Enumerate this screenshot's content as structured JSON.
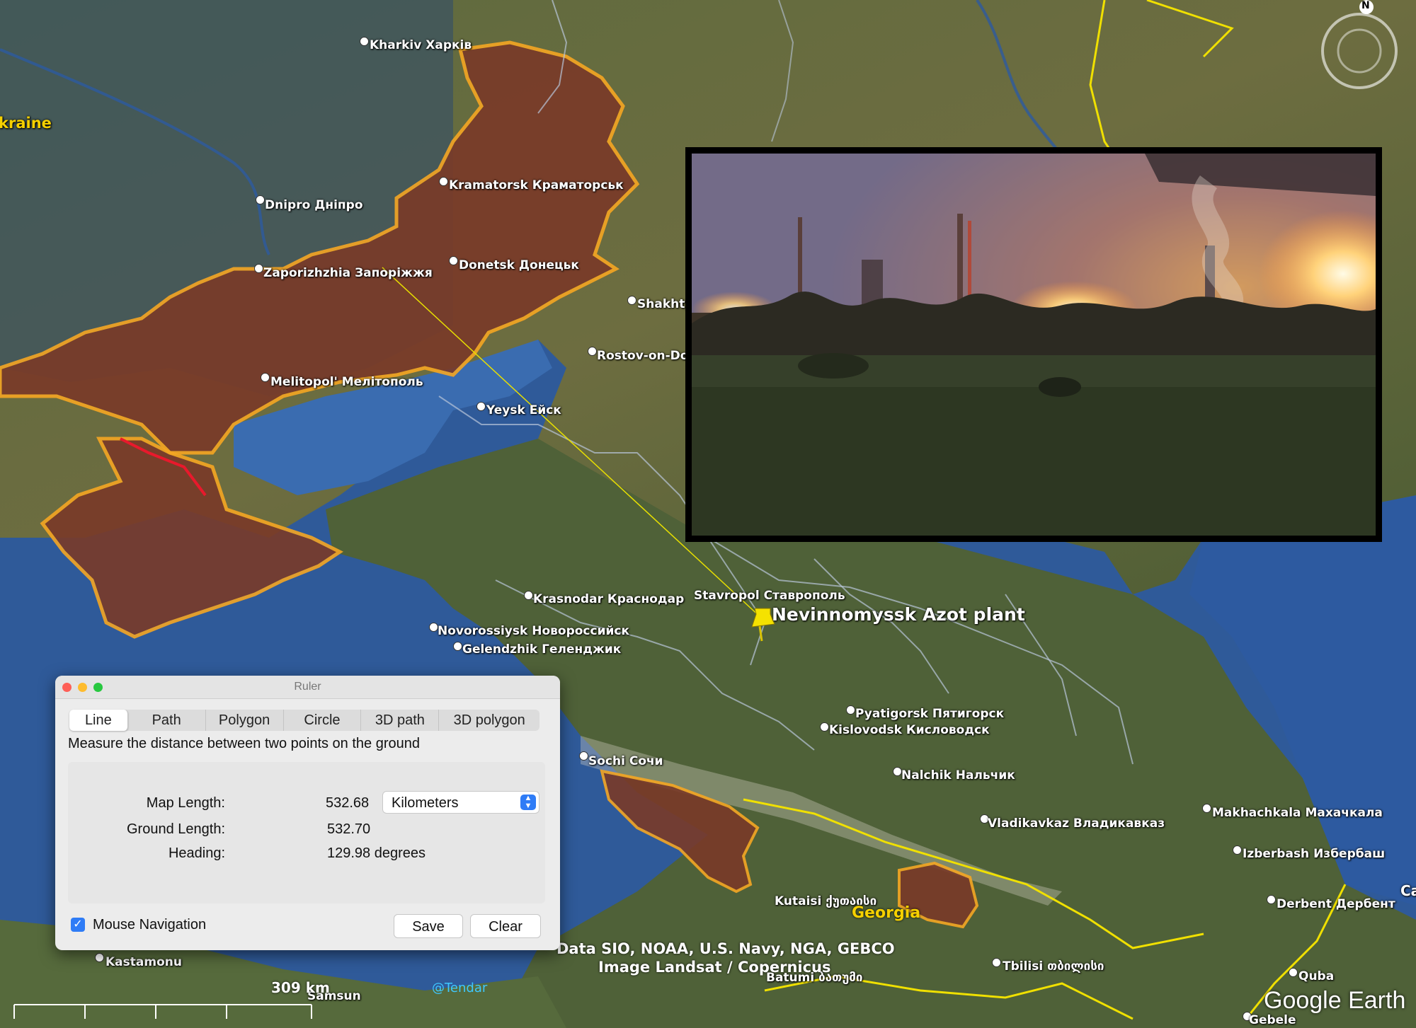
{
  "map": {
    "cities": [
      {
        "label": "Kharkiv Харків"
      },
      {
        "label": "Kramatorsk Краматорськ"
      },
      {
        "label": "Dnipro Дніпро"
      },
      {
        "label": "Donetsk Донецьк"
      },
      {
        "label": "Zaporizhzhia Запоріжжя"
      },
      {
        "label": "Shakhty"
      },
      {
        "label": "Rostov-on-Do"
      },
      {
        "label": "Melitopol' Мелітополь"
      },
      {
        "label": "Yeysk Ейск"
      },
      {
        "label": "Krasnodar Краснодар"
      },
      {
        "label": "Stavropol Ставрополь"
      },
      {
        "label": "Novorossiysk Новороссийск"
      },
      {
        "label": "Gelendzhik Геленджик"
      },
      {
        "label": "Pyatigorsk Пятигорск"
      },
      {
        "label": "Kislovodsk Кисловодск"
      },
      {
        "label": "Sochi Сочи"
      },
      {
        "label": "Nalchik Нальчик"
      },
      {
        "label": "Vladikavkaz Владикавказ"
      },
      {
        "label": "Makhachkala Махачкала"
      },
      {
        "label": "Izberbash Избербаш"
      },
      {
        "label": "Derbent Дербент"
      },
      {
        "label": "Kutaisi ქუთაისი"
      },
      {
        "label": "Tbilisi თბილისი"
      },
      {
        "label": "Batumi ბათუმი"
      },
      {
        "label": "Kastamonu"
      },
      {
        "label": "Samsun"
      },
      {
        "label": "Quba"
      },
      {
        "label": "Gebele"
      }
    ],
    "partial_labels": {
      "ukraine": "kraine",
      "edge_ca": "Ca"
    },
    "country_labels": {
      "georgia": "Georgia"
    },
    "placemark": {
      "label": "Nevinnomyssk Azot plant"
    },
    "scale": "309 km",
    "watermark": "@Tendar",
    "compass_letter": "N",
    "credits": {
      "data": "Data SIO, NOAA, U.S. Navy, NGA, GEBCO",
      "imagery": "Image Landsat / Copernicus"
    },
    "brand": "Google Earth",
    "colors": {
      "occupied_fill": "#7a3a28",
      "occupied_border": "#f5a623",
      "border_red": "#e8192c",
      "ruler_line": "#e8e000",
      "sea": "#2f5a99"
    }
  },
  "ruler": {
    "title": "Ruler",
    "tabs": [
      "Line",
      "Path",
      "Polygon",
      "Circle",
      "3D path",
      "3D polygon"
    ],
    "description": "Measure the distance between two points on the ground",
    "map_length_label": "Map Length:",
    "map_length_value": "532.68",
    "units": "Kilometers",
    "ground_length_label": "Ground Length:",
    "ground_length_value": "532.70",
    "heading_label": "Heading:",
    "heading_value": "129.98 degrees",
    "mouse_nav_label": "Mouse Navigation",
    "mouse_nav_checked": true,
    "save_label": "Save",
    "clear_label": "Clear"
  }
}
